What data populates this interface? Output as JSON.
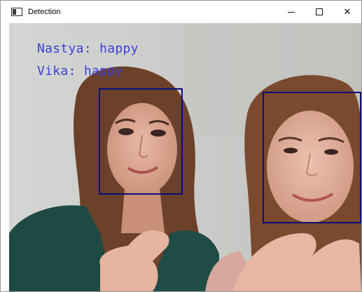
{
  "window": {
    "title": "Detection",
    "controls": {
      "minimize": "minimize",
      "maximize": "maximize",
      "close": "✕"
    }
  },
  "overlay": {
    "labels": [
      {
        "name": "Nastya",
        "emotion": "happy",
        "text": "Nastya: happy"
      },
      {
        "name": "Vika",
        "emotion": "happy",
        "text": "Vika: happy"
      }
    ],
    "label_color": "#3b3fd6",
    "box_color": "#0b0e7a"
  }
}
